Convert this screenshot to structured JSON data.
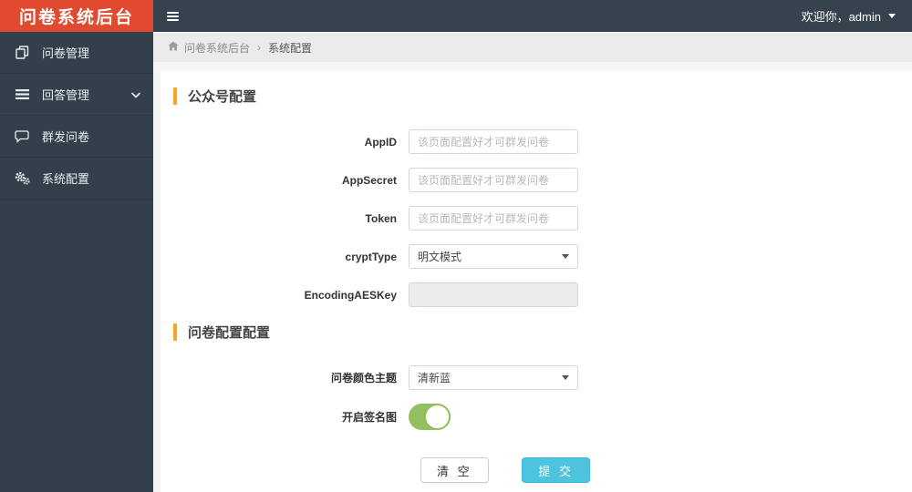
{
  "brand": {
    "title": "问卷系统后台"
  },
  "navbar": {
    "greeting": "欢迎你，admin"
  },
  "sidebar": {
    "items": [
      {
        "label": "问卷管理",
        "icon": "copy-icon"
      },
      {
        "label": "回答管理",
        "icon": "list-icon",
        "has_submenu": true
      },
      {
        "label": "群发问卷",
        "icon": "chat-icon"
      },
      {
        "label": "系统配置",
        "icon": "gears-icon"
      }
    ]
  },
  "breadcrumb": {
    "root": "问卷系统后台",
    "separator": "›",
    "current": "系统配置"
  },
  "wechat_section": {
    "title": "公众号配置",
    "fields": {
      "appid": {
        "label": "AppID",
        "placeholder": "该页面配置好才可群发问卷",
        "value": ""
      },
      "appsecret": {
        "label": "AppSecret",
        "placeholder": "该页面配置好才可群发问卷",
        "value": ""
      },
      "token": {
        "label": "Token",
        "placeholder": "该页面配置好才可群发问卷",
        "value": ""
      },
      "crypt_type": {
        "label": "cryptType",
        "value": "明文模式"
      },
      "encoding_aes_key": {
        "label": "EncodingAESKey",
        "value": "",
        "disabled": true
      }
    }
  },
  "survey_section": {
    "title": "问卷配置配置",
    "fields": {
      "color_theme": {
        "label": "问卷颜色主题",
        "value": "清新蓝"
      },
      "signature": {
        "label": "开启签名图",
        "state": "on"
      }
    }
  },
  "actions": {
    "clear": "清 空",
    "submit": "提 交"
  },
  "colors": {
    "brand_orange": "#e04b2f",
    "navbar_dark": "#36424e",
    "sidebar_dark": "#333f4a",
    "accent_orange": "#f5a428",
    "submit_blue": "#4ec3e0",
    "toggle_green": "#94bf5e"
  }
}
